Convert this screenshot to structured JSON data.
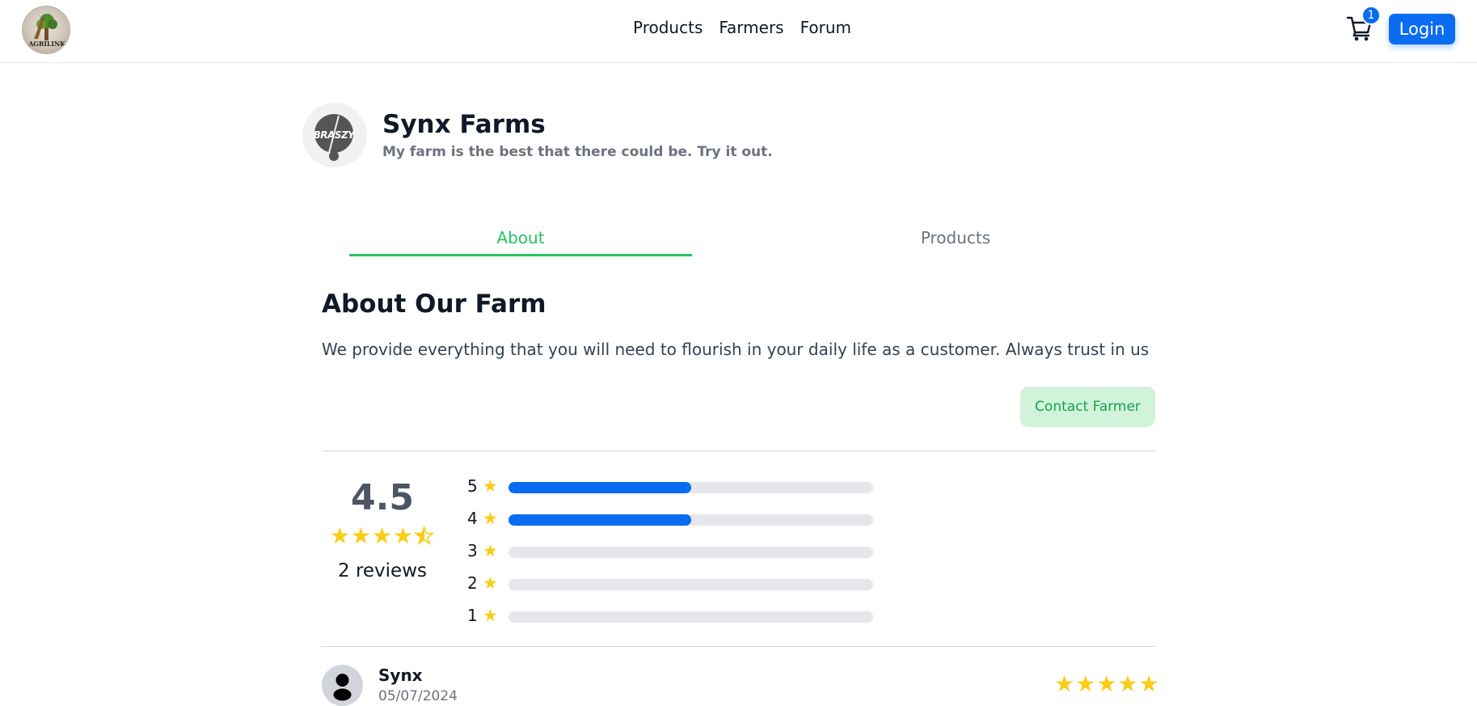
{
  "navbar": {
    "logo_text": "AGRILINK",
    "links": [
      "Products",
      "Farmers",
      "Forum"
    ],
    "cart_count": "1",
    "login_label": "Login",
    "accent_color": "#0a6cf0"
  },
  "farm": {
    "avatar_text": "BRASZY",
    "name": "Synx Farms",
    "tagline": "My farm is the best that there could be. Try it out."
  },
  "tabs": [
    {
      "label": "About",
      "active": true
    },
    {
      "label": "Products",
      "active": false
    }
  ],
  "about": {
    "title": "About Our Farm",
    "description": "We provide everything that you will need to flourish in your daily life as a customer. Always trust in us",
    "contact_label": "Contact Farmer"
  },
  "ratings": {
    "average": "4.5",
    "average_value": 4.5,
    "review_count_label": "2 reviews",
    "breakdown": [
      {
        "stars": "5",
        "fraction": 0.5
      },
      {
        "stars": "4",
        "fraction": 0.5
      },
      {
        "stars": "3",
        "fraction": 0
      },
      {
        "stars": "2",
        "fraction": 0
      },
      {
        "stars": "1",
        "fraction": 0
      }
    ],
    "star_color": "#facc15"
  },
  "reviews": [
    {
      "name": "Synx",
      "date": "05/07/2024",
      "rating": 5
    }
  ]
}
